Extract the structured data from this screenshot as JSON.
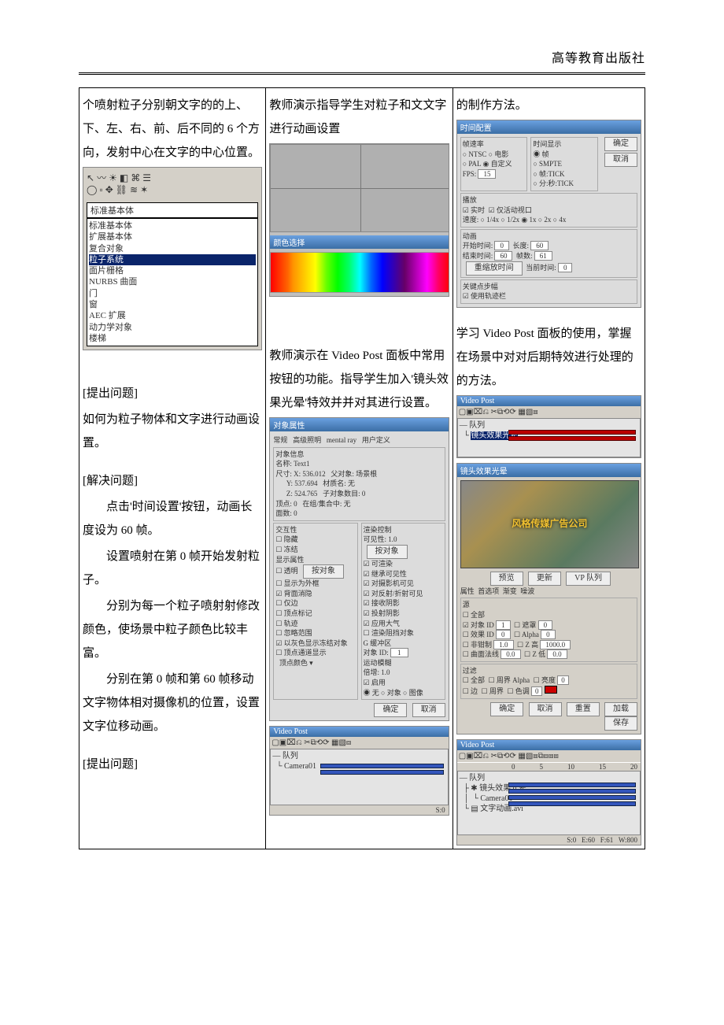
{
  "header": {
    "publisher": "高等教育出版社"
  },
  "col1": {
    "para1": "个喷射粒子分别朝文字的的上、下、左、右、前、后不同的 6 个方向，发射中心在文字的中心位置。",
    "dropdown_panel": {
      "selected": "标准基本体",
      "items": [
        "标准基本体",
        "扩展基本体",
        "复合对象",
        "粒子系统",
        "面片栅格",
        "NURBS 曲面",
        "门",
        "窗",
        "AEC 扩展",
        "动力学对象",
        "楼梯"
      ],
      "highlight_index": 3
    },
    "h1": "[提出问题]",
    "para2": "如何为粒子物体和文字进行动画设置。",
    "h2": "[解决问题]",
    "para3": "点击'时间设置'按钮，动画长度设为 60 帧。",
    "para4": "设置喷射在第 0 帧开始发射粒子。",
    "para5": "分别为每一个粒子喷射射修改颜色，使场景中粒子颜色比较丰富。",
    "para6": "分别在第 0 帧和第 60 帧移动文字物体相对摄像机的位置，设置文字位移动画。",
    "h3": "[提出问题]"
  },
  "col2": {
    "para1": "教师演示指导学生对粒子和文文字进行动画设置",
    "color_dialog": {
      "title": "颜色选择"
    },
    "para2": "教师演示在 Video Post 面板中常用按钮的功能。指导学生加入'镜头效果光晕'特效并并对其进行设置。",
    "prop_dialog": {
      "title": "对象属性",
      "tabs": [
        "常规",
        "高级照明",
        "mental ray",
        "用户定义"
      ],
      "group_info": "对象信息",
      "name_label": "名称:",
      "name_value": "Text1",
      "size_x_label": "尺寸:",
      "size_x": "X: 536.012",
      "size_y": "Y: 537.694",
      "size_z": "Z: 524.765",
      "vtx_label": "顶点:",
      "vtx_value": "0",
      "face_label": "面数:",
      "face_value": "0",
      "parent_label": "父对象:",
      "parent_value": "场景根",
      "mat_label": "材质名:",
      "mat_value": "无",
      "child_label": "子对象数目:",
      "child_value": "0",
      "group_label": "在组/集合中:",
      "group_value": "无",
      "interact": "交互性",
      "cb_hide": "隐藏",
      "cb_freeze": "冻结",
      "display": "显示属性",
      "cb_seethrough": "透明",
      "cb_edge": "显示为外框",
      "cb_bkface": "背面消隐",
      "cb_edges": "仅边",
      "cb_vtick": "顶点标记",
      "cb_traj": "轨迹",
      "cb_ignore": "忽略范围",
      "cb_grey": "以灰色显示冻结对象",
      "cb_vcol": "顶点通道显示",
      "vtx_color": "顶点颜色",
      "render_ctl": "渲染控制",
      "visibility": "可见性:",
      "visibility_val": "1.0",
      "cb_inherit": "继承可见性",
      "cb_rend": "可渲染",
      "cb_rvis": "对摄影机可见",
      "cb_reflvis": "对反射/折射可见",
      "cb_rcvsh": "接收阴影",
      "cb_castsh": "投射阴影",
      "cb_atmos": "应用大气",
      "cb_occl": "渲染阻挡对象",
      "gbuf": "G 缓冲区",
      "objid": "对象 ID:",
      "objid_val": "1",
      "blur": "运动模糊",
      "factor": "倍增:",
      "factor_val": "1.0",
      "enable": "启用",
      "opt_none": "无",
      "opt_obj": "对象",
      "opt_img": "图像",
      "btn_byobj": "按对象",
      "btn_byob2": "按对象",
      "ok": "确定",
      "cancel": "取消"
    },
    "vpost1": {
      "title": "Video Post",
      "tree1": "队列",
      "tree2": "Camera01",
      "status": "S:0"
    }
  },
  "col3": {
    "para1": "的制作方法。",
    "time_dialog": {
      "title": "时间配置",
      "fps_group": "帧速率",
      "rb_ntsc": "NTSC",
      "rb_pal": "PAL",
      "rb_film": "电影",
      "rb_custom": "自定义",
      "fps_label": "FPS:",
      "fps_value": "15",
      "timedisp": "时间显示",
      "rb_frame": "帧",
      "rb_smpte": "SMPTE",
      "rb_tick": "帧:TICK",
      "rb_mmss": "分:秒:TICK",
      "btn_ok": "确定",
      "btn_cancel": "取消",
      "play_group": "播放",
      "cb_rt": "实时",
      "cb_activeonly": "仅活动视口",
      "speed": "速度:",
      "s14": "1/4x",
      "s12": "1/2x",
      "s1": "1x",
      "s2": "2x",
      "s4": "4x",
      "anim": "动画",
      "start": "开始时间:",
      "start_v": "0",
      "end": "长度:",
      "end_v": "60",
      "len": "结束时间:",
      "len_v": "60",
      "fcount": "帧数:",
      "fcount_v": "61",
      "rescale": "重缩放时间",
      "cur": "当前时间:",
      "cur_v": "0",
      "keystep": "关键点步幅",
      "cb_usebar": "使用轨迹栏"
    },
    "para2": "学习 Video Post 面板的使用，掌握在场景中对对后期特效进行处理的的方法。",
    "vpost2": {
      "title": "Video Post",
      "tree1": "队列",
      "tree2": "镜头效果光晕"
    },
    "glow_dialog": {
      "title": "镜头效果光晕",
      "render_text": "风格传媒广告公司",
      "btn_preview": "预览",
      "btn_update": "更新",
      "btn_vp": "VP 队列",
      "tabs": [
        "属性",
        "首选项",
        "渐变",
        "噪波"
      ],
      "grp_src": "源",
      "cb_all": "全部",
      "cb_objid": "对象 ID",
      "objid_v": "1",
      "cb_effid": "效果 ID",
      "effid_v": "0",
      "cb_noclamp": "非钳制",
      "noclamp_v": "1.0",
      "cb_mask": "遮罩",
      "mask_v": "0",
      "cb_surf": "曲面法线",
      "surf_v": "0.0",
      "cb_alpha": "Alpha",
      "alpha_v": "0",
      "cb_zhi": "Z 高",
      "zhi_v": "1000.0",
      "cb_zlo": "Z 低",
      "zlo_v": "0.0",
      "grp_filter": "过滤",
      "cb_all2": "全部",
      "cb_perim": "周界 Alpha",
      "cb_bright": "亮度",
      "bright_v": "0",
      "cb_edge": "边",
      "cb_hue": "色调",
      "hue_v": "0",
      "cb_perim2": "周界",
      "btn_ok": "确定",
      "btn_cancel": "取消",
      "btn_reset": "重置",
      "btn_load": "加载",
      "btn_save": "保存"
    },
    "vpost3": {
      "title": "Video Post",
      "ticks": [
        "0",
        "5",
        "10",
        "15",
        "20"
      ],
      "tree1": "队列",
      "tree2": "镜头效果光晕",
      "tree3": "Camera01",
      "tree4": "文字动画.avi",
      "status_s": "S:0",
      "status_e": "E:60",
      "status_f": "F:61",
      "status_w": "W:800"
    }
  }
}
